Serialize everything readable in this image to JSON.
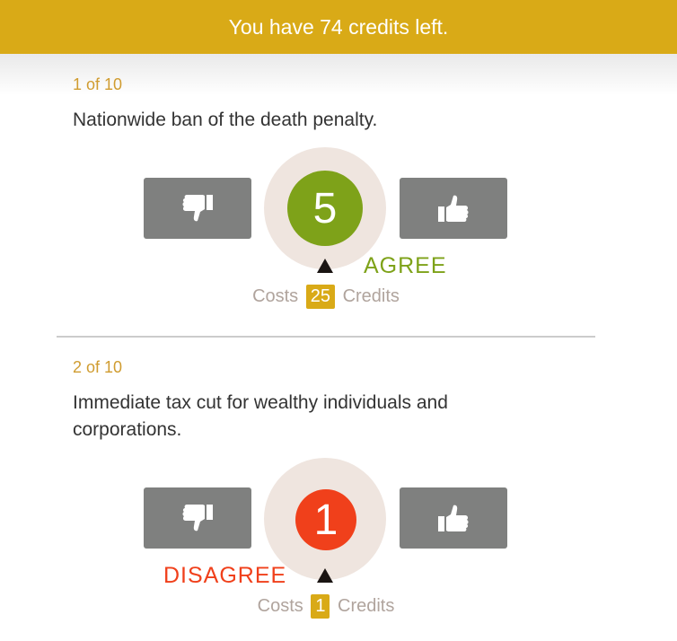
{
  "banner": {
    "text": "You have 74 credits left."
  },
  "questions": [
    {
      "count": "1 of 10",
      "text": "Nationwide ban of the death penalty.",
      "votes": "5",
      "stance": "AGREE",
      "cost_prefix": "Costs",
      "cost_value": "25",
      "cost_suffix": "Credits",
      "dial_color": "#7ea219",
      "stance_color": "#7ea219"
    },
    {
      "count": "2 of 10",
      "text": "Immediate tax cut for wealthy individuals and corporations.",
      "votes": "1",
      "stance": "DISAGREE",
      "cost_prefix": "Costs",
      "cost_value": "1",
      "cost_suffix": "Credits",
      "dial_color": "#f0401b",
      "stance_color": "#f0401b"
    }
  ],
  "colors": {
    "banner": "#d9aa17",
    "button": "#7f807f",
    "dial_ring": "#efe5df"
  },
  "icons": {
    "downvote": "thumbs-down-icon",
    "upvote": "thumbs-up-icon"
  }
}
